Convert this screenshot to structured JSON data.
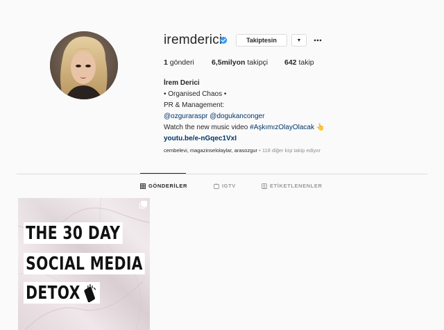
{
  "profile": {
    "username": "iremderici",
    "verified": true,
    "following_button_label": "Takiptesin",
    "dropdown_icon": "caret-down-icon",
    "more_icon": "more-horizontal-icon"
  },
  "stats": {
    "posts_count": "1",
    "posts_label": "gönderi",
    "followers_count": "6,5milyon",
    "followers_label": "takipçi",
    "following_count": "642",
    "following_label": "takip"
  },
  "bio": {
    "name": "İrem Derici",
    "line1": "• Organised Chaos •",
    "line2": "PR & Management:",
    "mention1": "@ozguraraspr",
    "mention2": "@dogukanconger",
    "line4_prefix": "Watch the new music video ",
    "hashtag": "#AşkımızOlayOlacak",
    "emoji": "👆",
    "website": "youtu.be/e-nGqec1VxI"
  },
  "followed_by": {
    "users": "cembelevi, magazinselolaylar, arasozgur",
    "others": " • 118 diğer kişi takip ediyor"
  },
  "tabs": [
    {
      "label": "GÖNDERİLER",
      "icon": "grid-icon",
      "active": true
    },
    {
      "label": "IGTV",
      "icon": "igtv-icon",
      "active": false
    },
    {
      "label": "ETİKETLENENLER",
      "icon": "tagged-icon",
      "active": false
    }
  ],
  "post": {
    "lines": [
      "THE 30 DAY",
      "SOCIAL MEDIA",
      "DETOX"
    ],
    "line3_icon": "phone-cross-icon",
    "multi_icon": "carousel-icon"
  },
  "colors": {
    "link": "#003569",
    "verified": "#3897f0",
    "muted": "#8e8e8e",
    "border": "#dbdbdb"
  }
}
